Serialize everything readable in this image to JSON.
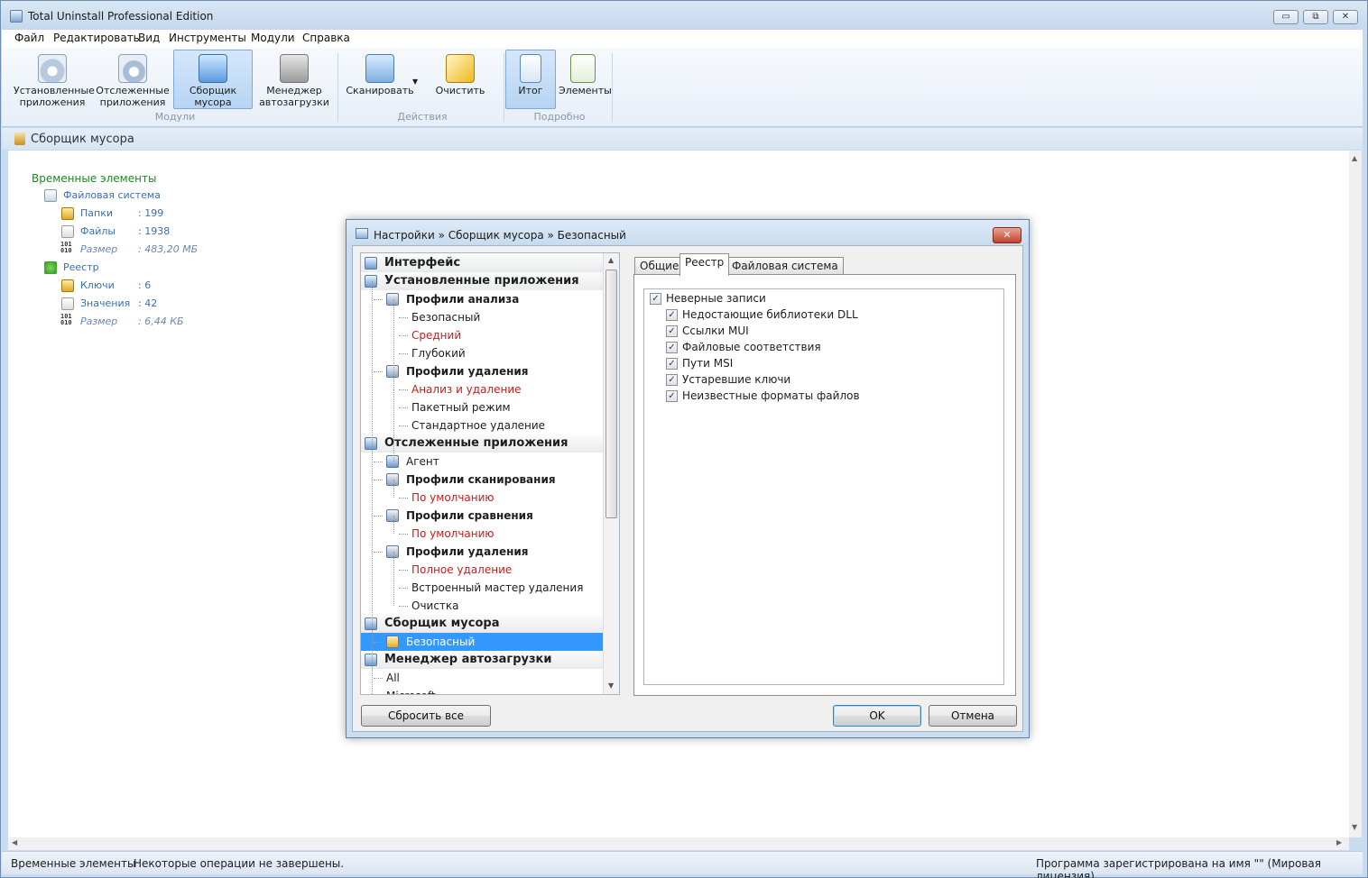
{
  "window": {
    "title": "Total Uninstall Professional Edition",
    "controls": {
      "minimize": "▭",
      "restore": "⧉",
      "close": "✕"
    }
  },
  "menu": [
    "Файл",
    "Редактировать",
    "Вид",
    "Инструменты",
    "Модули",
    "Справка"
  ],
  "ribbon": {
    "groups": {
      "modules": "Модули",
      "actions": "Действия",
      "details": "Подробно"
    },
    "buttons": {
      "installed": "Установленные\nприложения",
      "tracked": "Отслеженные\nприложения",
      "junk": "Сборщик\nмусора",
      "autorun": "Менеджер\nавтозагрузки",
      "scan": "Сканировать",
      "clean": "Очистить",
      "summary": "Итог",
      "elements": "Элементы"
    },
    "active": [
      "junk",
      "summary"
    ]
  },
  "path": {
    "text": "Сборщик мусора"
  },
  "content": {
    "root": "Временные элементы",
    "filesystem": {
      "label": "Файловая система",
      "folders": {
        "label": "Папки",
        "value": ":  199"
      },
      "files": {
        "label": "Файлы",
        "value": ":  1938"
      },
      "size": {
        "label": "Размер",
        "value": ": 483,20 МБ"
      }
    },
    "registry": {
      "label": "Реестр",
      "keys": {
        "label": "Ключи",
        "value": ":    6"
      },
      "values": {
        "label": "Значения",
        "value": ":   42"
      },
      "size": {
        "label": "Размер",
        "value": ": 6,44 КБ"
      }
    }
  },
  "status": {
    "left": "Временные элементы",
    "middle": "Некоторые операции не завершены.",
    "right": "Программа зарегистрирована на имя \"\" (Мировая лицензия)"
  },
  "dialog": {
    "title": "Настройки » Сборщик мусора » Безопасный",
    "close": "✕",
    "tree": [
      {
        "text": "Интерфейс",
        "level": 0,
        "kind": "cat"
      },
      {
        "text": "Установленные приложения",
        "level": 0,
        "kind": "cat"
      },
      {
        "text": "Профили анализа",
        "level": 1,
        "kind": "sub"
      },
      {
        "text": "Безопасный",
        "level": 2,
        "kind": "leaf"
      },
      {
        "text": "Средний",
        "level": 2,
        "kind": "red"
      },
      {
        "text": "Глубокий",
        "level": 2,
        "kind": "leaf"
      },
      {
        "text": "Профили удаления",
        "level": 1,
        "kind": "sub"
      },
      {
        "text": "Анализ и удаление",
        "level": 2,
        "kind": "red"
      },
      {
        "text": "Пакетный режим",
        "level": 2,
        "kind": "leaf"
      },
      {
        "text": "Стандартное удаление",
        "level": 2,
        "kind": "leaf"
      },
      {
        "text": "Отслеженные приложения",
        "level": 0,
        "kind": "cat"
      },
      {
        "text": "Агент",
        "level": 1,
        "kind": "leaf"
      },
      {
        "text": "Профили сканирования",
        "level": 1,
        "kind": "sub"
      },
      {
        "text": "По умолчанию",
        "level": 2,
        "kind": "red"
      },
      {
        "text": "Профили сравнения",
        "level": 1,
        "kind": "sub"
      },
      {
        "text": "По умолчанию",
        "level": 2,
        "kind": "red"
      },
      {
        "text": "Профили удаления",
        "level": 1,
        "kind": "sub"
      },
      {
        "text": "Полное удаление",
        "level": 2,
        "kind": "red"
      },
      {
        "text": "Встроенный мастер удаления",
        "level": 2,
        "kind": "leaf"
      },
      {
        "text": "Очистка",
        "level": 2,
        "kind": "leaf"
      },
      {
        "text": "Сборщик мусора",
        "level": 0,
        "kind": "cat"
      },
      {
        "text": "Безопасный",
        "level": 1,
        "kind": "selected"
      },
      {
        "text": "Менеджер автозагрузки",
        "level": 0,
        "kind": "cat"
      },
      {
        "text": "All",
        "level": 1,
        "kind": "leaf"
      },
      {
        "text": "Microsoft",
        "level": 1,
        "kind": "leaf"
      }
    ],
    "tabs": [
      "Общие",
      "Реестр",
      "Файловая система"
    ],
    "active_tab": 1,
    "checks": [
      {
        "text": "Неверные записи",
        "checked": true,
        "level": 0
      },
      {
        "text": "Недостающие библиотеки DLL",
        "checked": true,
        "level": 1
      },
      {
        "text": "Ссылки MUI",
        "checked": true,
        "level": 1
      },
      {
        "text": "Файловые соответствия",
        "checked": true,
        "level": 1
      },
      {
        "text": "Пути MSI",
        "checked": true,
        "level": 1
      },
      {
        "text": "Устаревшие ключи",
        "checked": true,
        "level": 1
      },
      {
        "text": "Неизвестные форматы файлов",
        "checked": true,
        "level": 1
      }
    ],
    "buttons": {
      "reset": "Сбросить все",
      "ok": "OK",
      "cancel": "Отмена"
    }
  },
  "colors": {
    "accent": "#3399ff",
    "red_item": "#cc1a1a",
    "green_root": "#1f8a1f",
    "blue_link": "#3a6fb0"
  }
}
